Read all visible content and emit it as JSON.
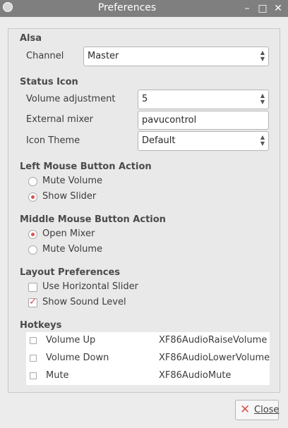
{
  "window": {
    "title": "Preferences",
    "minimize_glyph": "–",
    "maximize_glyph": "□",
    "close_glyph": "✕"
  },
  "alsa": {
    "heading": "Alsa",
    "channel_label": "Channel",
    "channel_value": "Master"
  },
  "status_icon": {
    "heading": "Status Icon",
    "volume_adjustment_label": "Volume adjustment",
    "volume_adjustment_value": "5",
    "external_mixer_label": "External mixer",
    "external_mixer_value": "pavucontrol",
    "icon_theme_label": "Icon Theme",
    "icon_theme_value": "Default"
  },
  "left_mouse": {
    "heading": "Left Mouse Button Action",
    "options": [
      {
        "label": "Mute Volume",
        "selected": false
      },
      {
        "label": "Show Slider",
        "selected": true
      }
    ]
  },
  "middle_mouse": {
    "heading": "Middle Mouse Button Action",
    "options": [
      {
        "label": "Open Mixer",
        "selected": true
      },
      {
        "label": "Mute Volume",
        "selected": false
      }
    ]
  },
  "layout": {
    "heading": "Layout Preferences",
    "options": [
      {
        "label": "Use Horizontal Slider",
        "checked": false
      },
      {
        "label": "Show Sound Level",
        "checked": true
      }
    ]
  },
  "hotkeys": {
    "heading": "Hotkeys",
    "rows": [
      {
        "name": "Volume Up",
        "key": "XF86AudioRaiseVolume",
        "checked": false
      },
      {
        "name": "Volume Down",
        "key": "XF86AudioLowerVolume",
        "checked": false
      },
      {
        "name": "Mute",
        "key": "XF86AudioMute",
        "checked": false
      }
    ]
  },
  "footer": {
    "close_label": "Close"
  },
  "colors": {
    "accent": "#d9534f",
    "titlebar": "#7f7f7f"
  }
}
